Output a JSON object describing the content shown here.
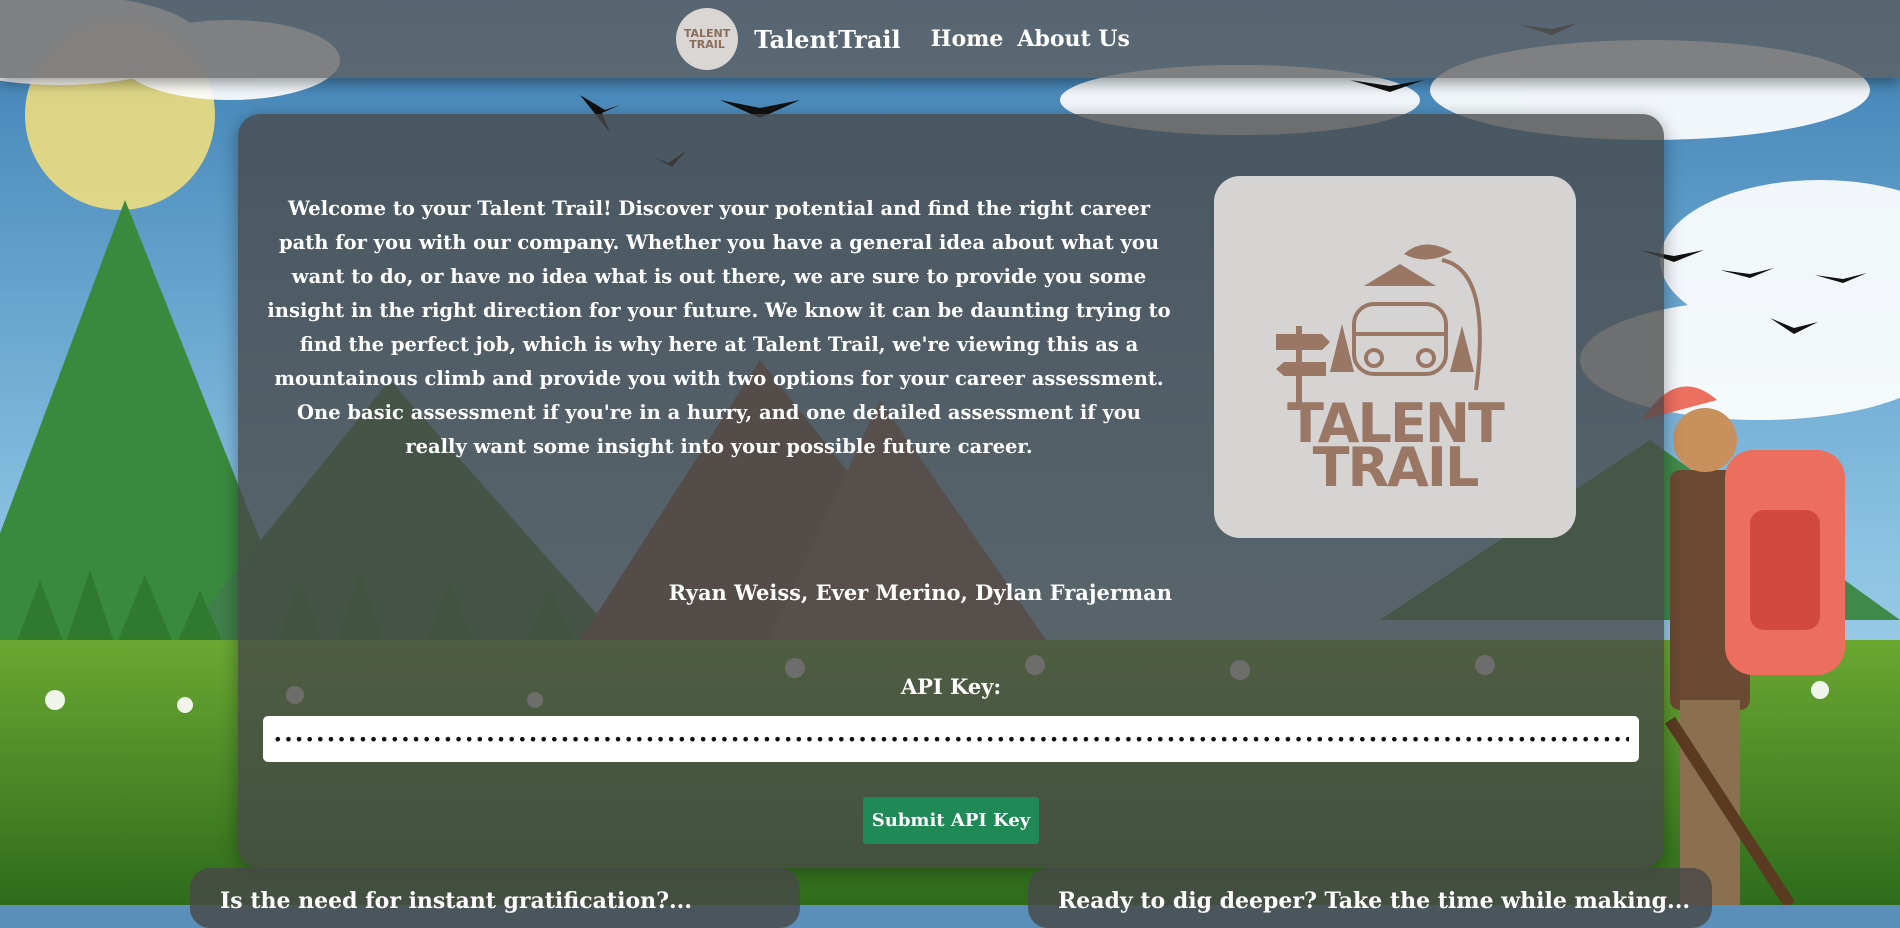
{
  "nav": {
    "logo_text": "TALENT TRAIL",
    "brand": "TalentTrail",
    "links": [
      "Home",
      "About Us"
    ]
  },
  "main": {
    "welcome_text": "Welcome to your Talent Trail! Discover your potential and find the right career path for you with our company. Whether you have a general idea about what you want to do, or have no idea what is out there, we are sure to provide you some insight in the right direction for your future. We know it can be daunting trying to find the perfect job, which is why here at Talent Trail, we're viewing this as a mountainous climb and provide you with two options for your career assessment. One basic assessment if you're in a hurry, and one detailed assessment if you really want some insight into your possible future career.",
    "logo_line1": "TALENT",
    "logo_line2": "TRAIL",
    "authors": "Ryan Weiss, Ever Merino, Dylan Frajerman",
    "api_label": "API Key:",
    "api_value": "••••••••••••••••••••••••••••••••••••••••••••••••••••••••••••••••••••••••••••••••••••••••••••••••••••••••••••••••••••••••••••••••••••••••••••",
    "submit_label": "Submit API Key"
  },
  "bottom_cards": {
    "basic_text": "Is the need for instant gratification?...",
    "detailed_text": "Ready to dig deeper? Take the time while making..."
  },
  "colors": {
    "card_bg": "#484848",
    "submit_bg": "#1f8a55",
    "logo_brown": "#9a7765"
  },
  "icons": [
    "bird-icon",
    "signpost-icon",
    "van-icon",
    "fishing-rod-icon"
  ]
}
